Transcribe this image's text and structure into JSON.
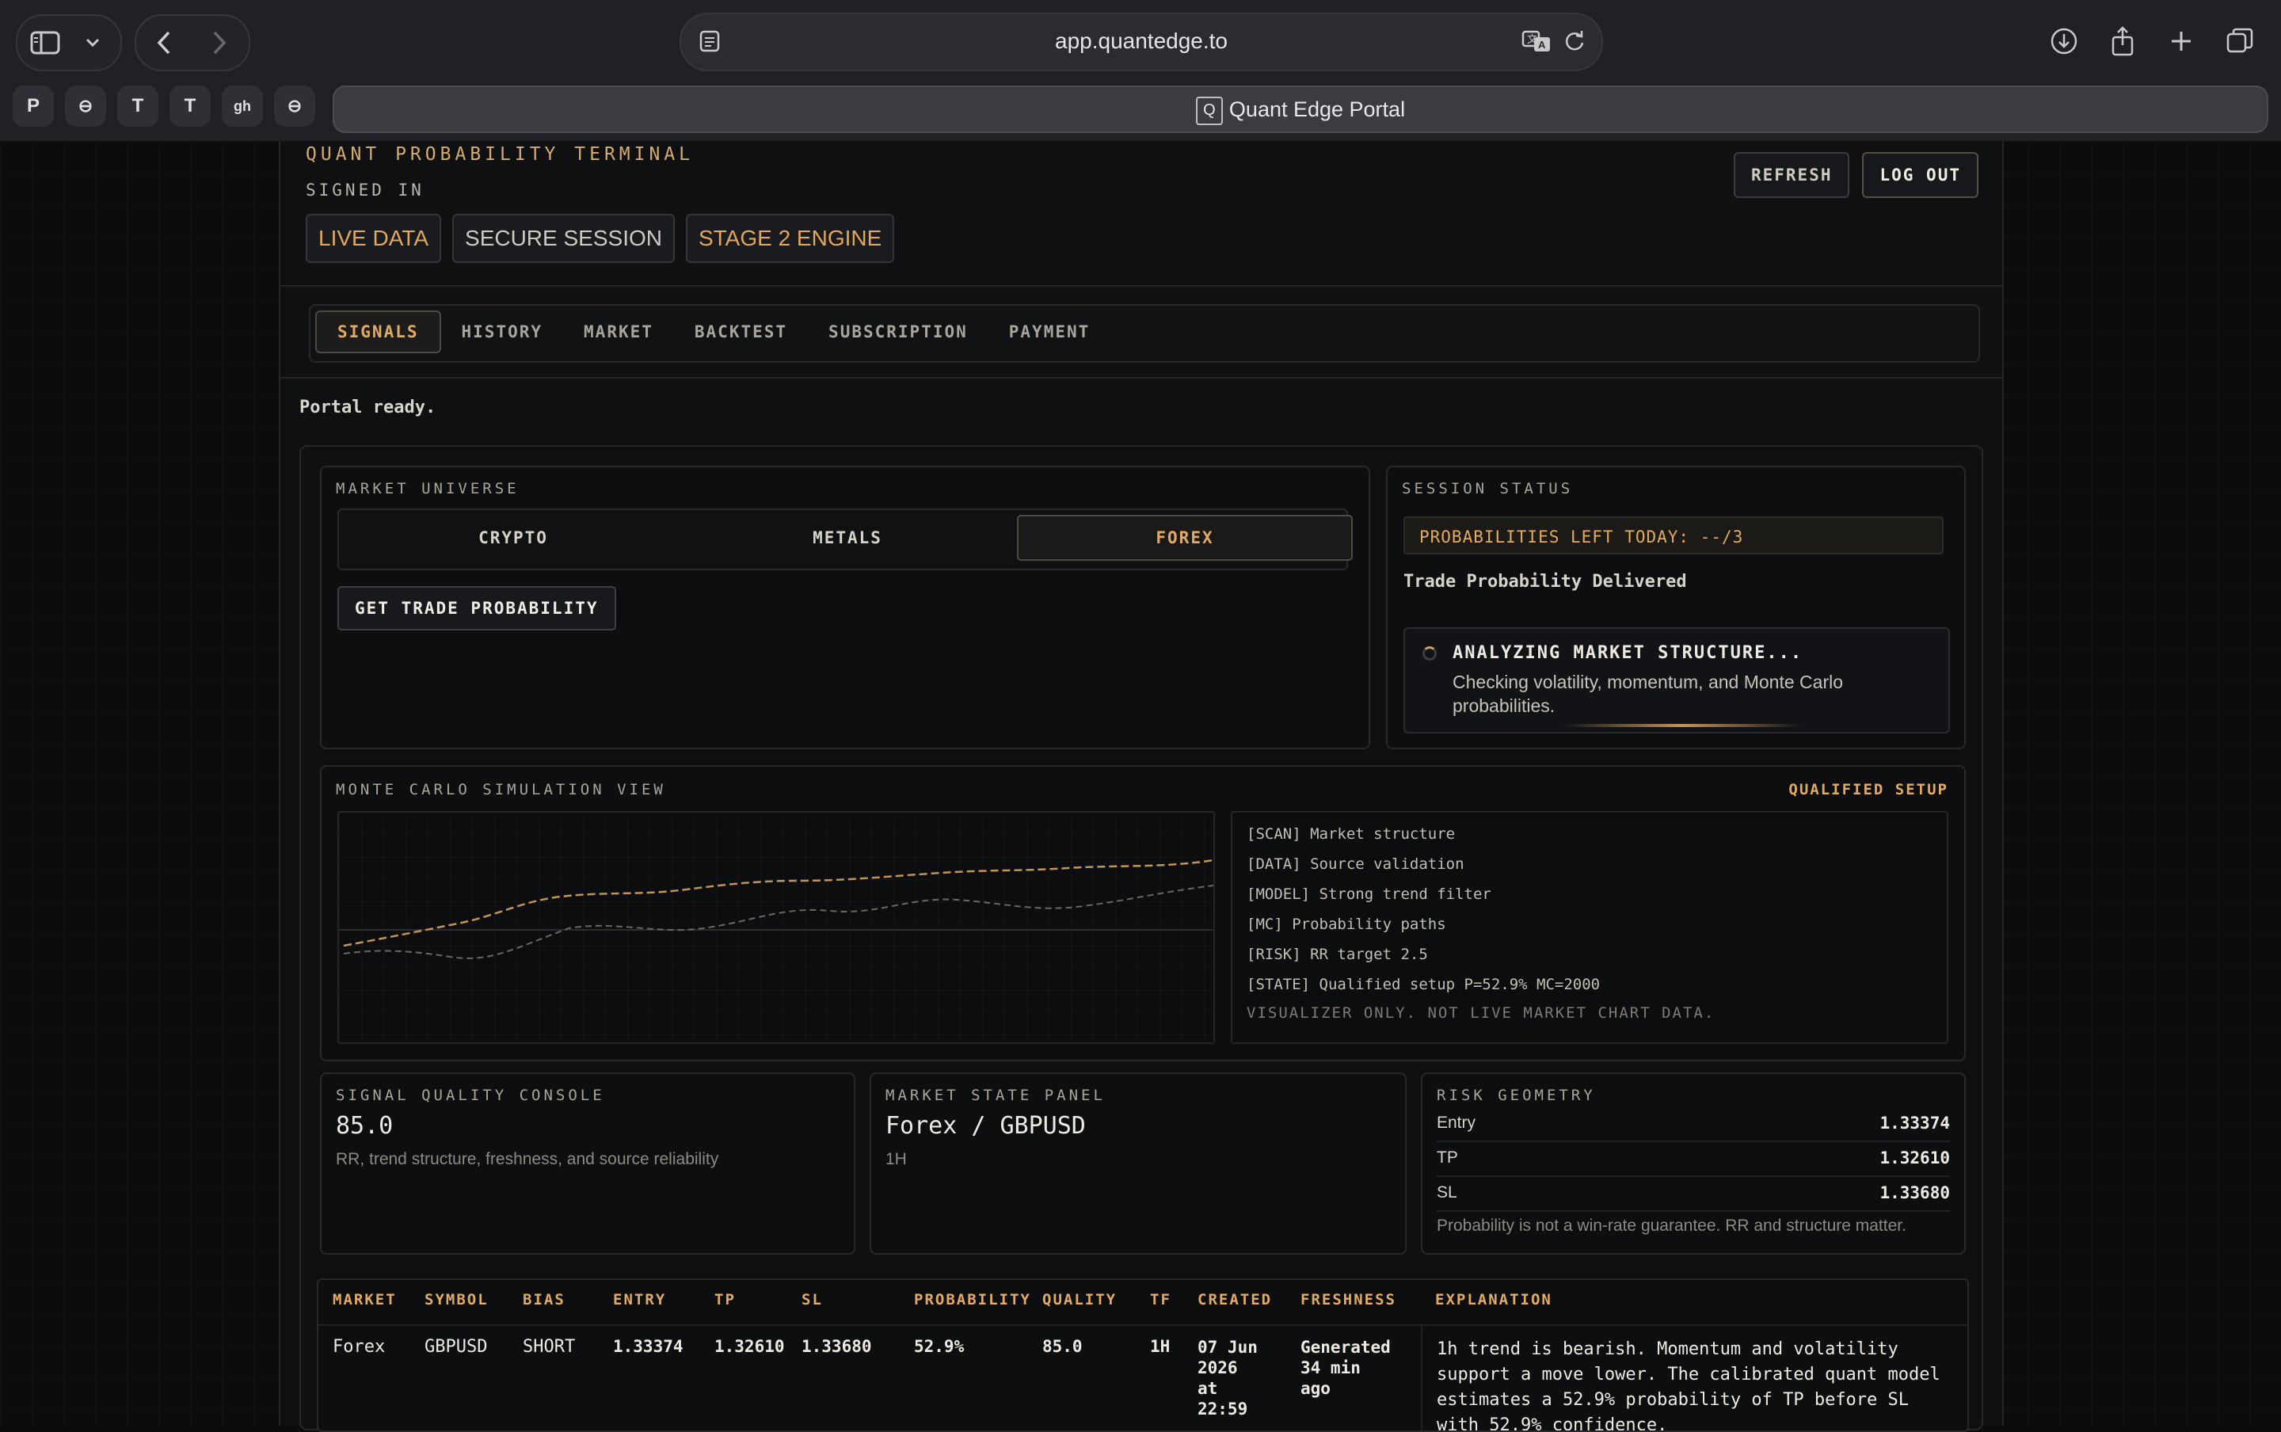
{
  "browser": {
    "url": "app.quantedge.to",
    "tab_title": "Quant Edge Portal",
    "tab_favicon_letter": "Q",
    "favorites": [
      "P",
      "⊖",
      "T",
      "T",
      "gh",
      "⊖"
    ]
  },
  "header": {
    "title": "QUANT PROBABILITY TERMINAL",
    "subtitle": "SIGNED IN",
    "chips": [
      "LIVE DATA",
      "SECURE SESSION",
      "STAGE 2 ENGINE"
    ],
    "refresh_label": "REFRESH",
    "logout_label": "LOG OUT"
  },
  "nav": {
    "tabs": [
      "SIGNALS",
      "HISTORY",
      "MARKET",
      "BACKTEST",
      "SUBSCRIPTION",
      "PAYMENT"
    ],
    "active": "SIGNALS"
  },
  "status_text": "Portal ready.",
  "market_universe": {
    "label": "MARKET UNIVERSE",
    "options": [
      "CRYPTO",
      "METALS",
      "FOREX"
    ],
    "selected": "FOREX",
    "action_label": "GET TRADE PROBABILITY"
  },
  "session_status": {
    "label": "SESSION STATUS",
    "probabilities_left": "PROBABILITIES LEFT TODAY: --/3",
    "delivered": "Trade Probability Delivered",
    "analyzing_title": "ANALYZING MARKET STRUCTURE...",
    "analyzing_desc": "Checking volatility, momentum, and Monte Carlo probabilities."
  },
  "monte_carlo": {
    "label": "MONTE CARLO SIMULATION VIEW",
    "badge": "QUALIFIED SETUP",
    "log": [
      "[SCAN] Market structure",
      "[DATA] Source validation",
      "[MODEL] Strong trend filter",
      "[MC] Probability paths",
      "[RISK] RR target 2.5",
      "[STATE] Qualified setup P=52.9% MC=2000"
    ],
    "disclaimer": "VISUALIZER ONLY. NOT LIVE MARKET CHART DATA.",
    "colors": {
      "path_primary": "#c49356",
      "path_secondary": "#6b6760"
    }
  },
  "signal_quality": {
    "label": "SIGNAL QUALITY CONSOLE",
    "value": "85.0",
    "desc": "RR, trend structure, freshness, and source reliability"
  },
  "market_state": {
    "label": "MARKET STATE PANEL",
    "value": "Forex / GBPUSD",
    "timeframe": "1H"
  },
  "risk_geometry": {
    "label": "RISK GEOMETRY",
    "rows": [
      {
        "k": "Entry",
        "v": "1.33374"
      },
      {
        "k": "TP",
        "v": "1.32610"
      },
      {
        "k": "SL",
        "v": "1.33680"
      }
    ],
    "note": "Probability is not a win-rate guarantee. RR and structure matter."
  },
  "table": {
    "headers": [
      "MARKET",
      "SYMBOL",
      "BIAS",
      "ENTRY",
      "TP",
      "SL",
      "PROBABILITY",
      "QUALITY",
      "TF",
      "CREATED",
      "FRESHNESS",
      "EXPLANATION"
    ],
    "row": {
      "market": "Forex",
      "symbol": "GBPUSD",
      "bias": "SHORT",
      "entry": "1.33374",
      "tp": "1.32610",
      "sl": "1.33680",
      "probability": "52.9%",
      "quality": "85.0",
      "tf": "1H",
      "created": [
        "07 Jun",
        "2026",
        "at",
        "22:59"
      ],
      "freshness": [
        "Generated",
        "34 min",
        "ago"
      ],
      "explanation": "1h trend is bearish. Momentum and volatility support a move lower. The calibrated quant model estimates a 52.9% probability of TP before SL with 52.9% confidence."
    }
  },
  "theme": {
    "accent": "#e2aa63",
    "background": "#0b0c0e",
    "panel": "#0d0e10"
  }
}
